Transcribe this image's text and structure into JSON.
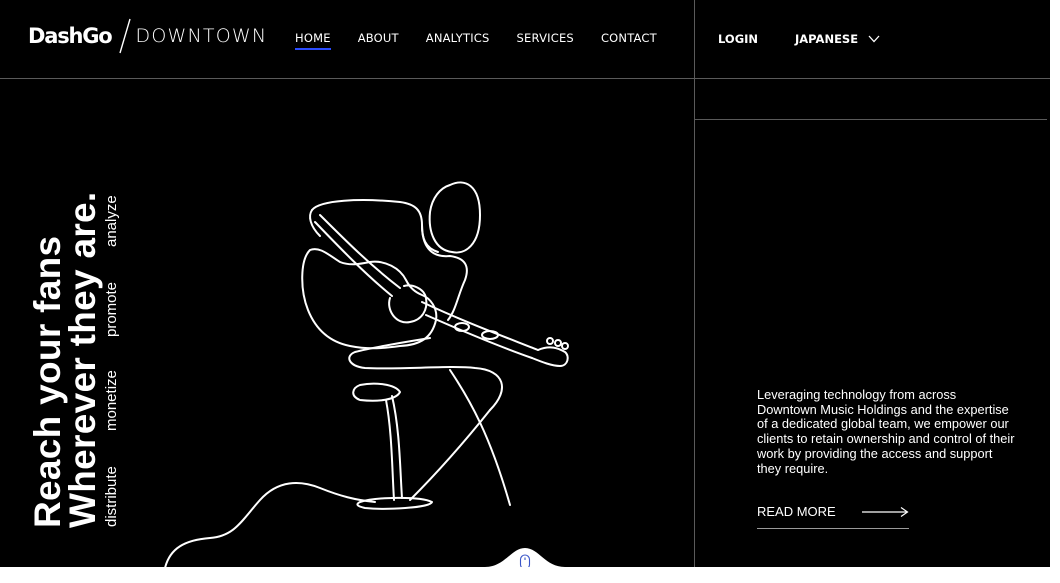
{
  "header": {
    "logo": {
      "brand": "DashGo",
      "sub": "DOWNTOWN"
    },
    "nav": [
      {
        "label": "HOME",
        "active": true
      },
      {
        "label": "ABOUT",
        "active": false
      },
      {
        "label": "ANALYTICS",
        "active": false
      },
      {
        "label": "SERVICES",
        "active": false
      },
      {
        "label": "CONTACT",
        "active": false
      }
    ],
    "login_label": "LOGIN",
    "language_label": "JAPANESE"
  },
  "hero": {
    "headline_line1": "Reach your fans",
    "headline_line2": "Wherever they are.",
    "verbs": [
      "distribute",
      "monetize",
      "promote",
      "analyze"
    ]
  },
  "about": {
    "description": "Leveraging technology from across Downtown Music Holdings and the expertise of a dedicated global team, we empower our clients to retain ownership and control of their work by providing the access and support they require.",
    "read_more_label": "READ MORE"
  },
  "icons": {
    "language_dropdown": "chevron-down-icon",
    "read_more": "arrow-right-icon",
    "scroll": "mouse-icon",
    "illustration": "guitarist-line-art"
  },
  "colors": {
    "background": "#000000",
    "text": "#ffffff",
    "accent": "#2b4cff",
    "divider": "#5a5a5a"
  }
}
